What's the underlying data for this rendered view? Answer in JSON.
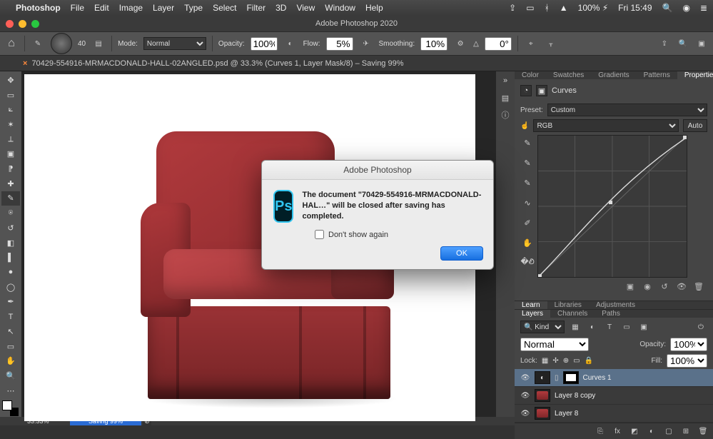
{
  "menubar": {
    "apple": "",
    "app": "Photoshop",
    "items": [
      "File",
      "Edit",
      "Image",
      "Layer",
      "Type",
      "Select",
      "Filter",
      "3D",
      "View",
      "Window",
      "Help"
    ],
    "battery": "100%",
    "clock": "Fri 15:49"
  },
  "window": {
    "title": "Adobe Photoshop 2020"
  },
  "optbar": {
    "brush_size": "40",
    "mode_label": "Mode:",
    "mode_value": "Normal",
    "opacity_label": "Opacity:",
    "opacity_value": "100%",
    "flow_label": "Flow:",
    "flow_value": "5%",
    "smoothing_label": "Smoothing:",
    "smoothing_value": "10%",
    "angle_icon": "△",
    "angle_value": "0°"
  },
  "doc": {
    "close_x": "×",
    "tab": "70429-554916-MRMACDONALD-HALL-02ANGLED.psd @ 33.3% (Curves 1, Layer Mask/8) – Saving 99%"
  },
  "dialog": {
    "title": "Adobe Photoshop",
    "ps": "Ps",
    "message": "The document \"70429-554916-MRMACDONALD-HAL…\" will be closed after saving has completed.",
    "dont_show": "Don't show again",
    "ok": "OK"
  },
  "panels": {
    "topTabs": [
      "Color",
      "Swatches",
      "Gradients",
      "Patterns",
      "Properties"
    ],
    "properties": {
      "type_label": "Curves",
      "preset_label": "Preset:",
      "preset_value": "Custom",
      "channel_value": "RGB",
      "auto": "Auto"
    },
    "midTabs": [
      "Learn",
      "Libraries",
      "Adjustments"
    ],
    "layersTabs": [
      "Layers",
      "Channels",
      "Paths"
    ],
    "layers": {
      "kind": "Kind",
      "blend": "Normal",
      "opacity_label": "Opacity:",
      "opacity_value": "100%",
      "lock_label": "Lock:",
      "fill_label": "Fill:",
      "fill_value": "100%",
      "items": [
        {
          "name": "Curves 1",
          "type": "adjustment",
          "selected": true
        },
        {
          "name": "Layer 8 copy",
          "type": "image",
          "selected": false
        },
        {
          "name": "Layer 8",
          "type": "image",
          "selected": false
        }
      ]
    }
  },
  "status": {
    "zoom": "33.33%",
    "saving": "Saving 99%",
    "stop": "⊘"
  }
}
